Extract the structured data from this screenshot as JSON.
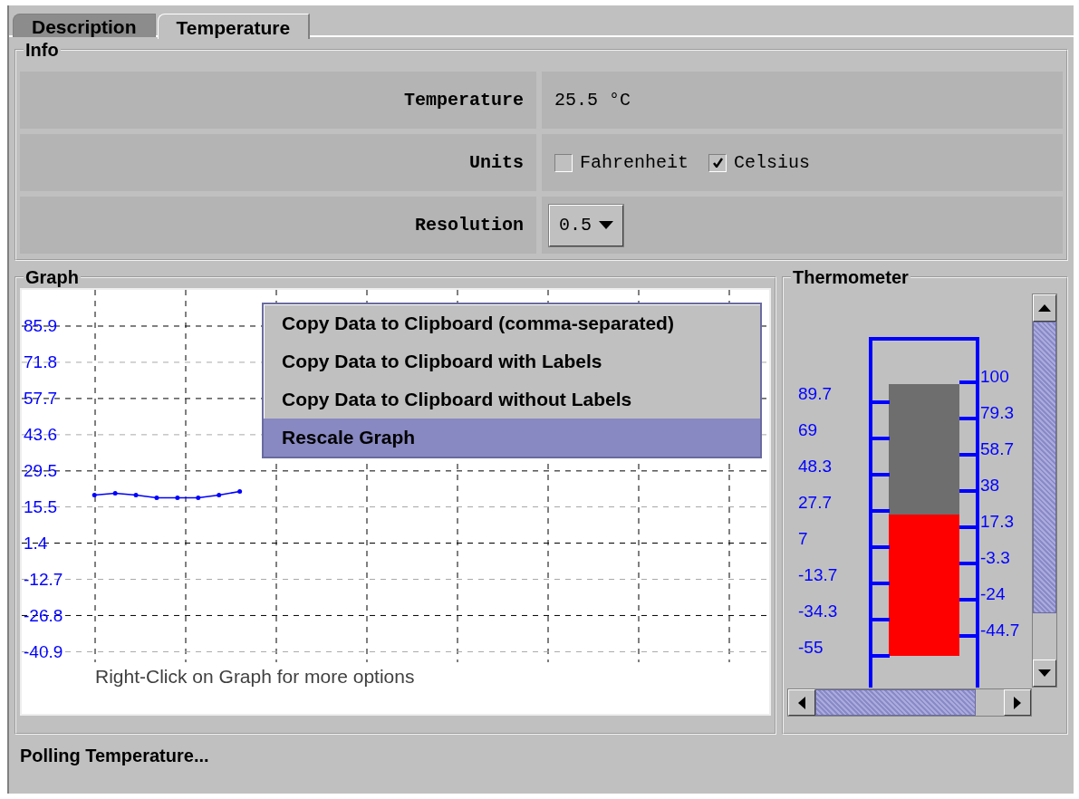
{
  "tabs": [
    {
      "label": "Description",
      "selected": false
    },
    {
      "label": "Temperature",
      "selected": true
    }
  ],
  "info": {
    "title": "Info",
    "rows": [
      {
        "kind": "text",
        "label": "Temperature",
        "value": "25.5 °C"
      },
      {
        "kind": "checkboxes",
        "label": "Units",
        "options": [
          {
            "label": "Fahrenheit",
            "checked": false
          },
          {
            "label": "Celsius",
            "checked": true
          }
        ]
      },
      {
        "kind": "dropdown",
        "label": "Resolution",
        "value": "0.5"
      }
    ]
  },
  "graph": {
    "title": "Graph",
    "hint": "Right-Click on Graph for more options",
    "chart_data": {
      "type": "line",
      "grid": true,
      "categories": [
        null,
        null,
        null,
        null,
        null,
        null,
        null,
        null,
        null,
        null,
        null,
        null,
        null,
        null,
        null,
        null,
        null,
        null,
        null,
        null,
        null,
        null,
        null,
        null,
        null,
        null,
        null,
        null,
        null,
        null,
        null,
        null,
        null,
        null,
        null,
        null
      ],
      "ylim": [
        -65.8,
        100.0
      ],
      "yticks": [
        85.9,
        71.8,
        57.7,
        43.6,
        29.5,
        15.5,
        1.4,
        -12.7,
        -26.8,
        -40.9
      ],
      "series": [
        {
          "color": "#0000ff",
          "values": [
            null,
            null,
            null,
            20.1,
            20.8,
            20.1,
            19.0,
            19.0,
            19.0,
            20.1,
            21.5,
            null,
            null,
            null,
            null,
            null,
            null,
            null,
            null,
            null,
            null,
            null,
            null,
            null,
            null,
            null,
            null,
            null,
            null,
            null,
            null,
            null,
            null,
            null,
            null,
            null
          ]
        }
      ]
    },
    "context_menu": [
      {
        "label": "Copy Data to Clipboard (comma-separated)",
        "selected": false
      },
      {
        "label": "Copy Data to Clipboard with Labels",
        "selected": false
      },
      {
        "label": "Copy Data to Clipboard without Labels",
        "selected": false
      },
      {
        "label": "Rescale Graph",
        "selected": true
      }
    ]
  },
  "thermometer": {
    "title": "Thermometer",
    "level": 0.52,
    "left_scale": [
      "89.7",
      "69",
      "48.3",
      "27.7",
      "7",
      "-13.7",
      "-34.3",
      "-55"
    ],
    "right_scale": [
      "100",
      "79.3",
      "58.7",
      "38",
      "17.3",
      "-3.3",
      "-24",
      "-44.7"
    ]
  },
  "status_bar": "Polling Temperature..."
}
